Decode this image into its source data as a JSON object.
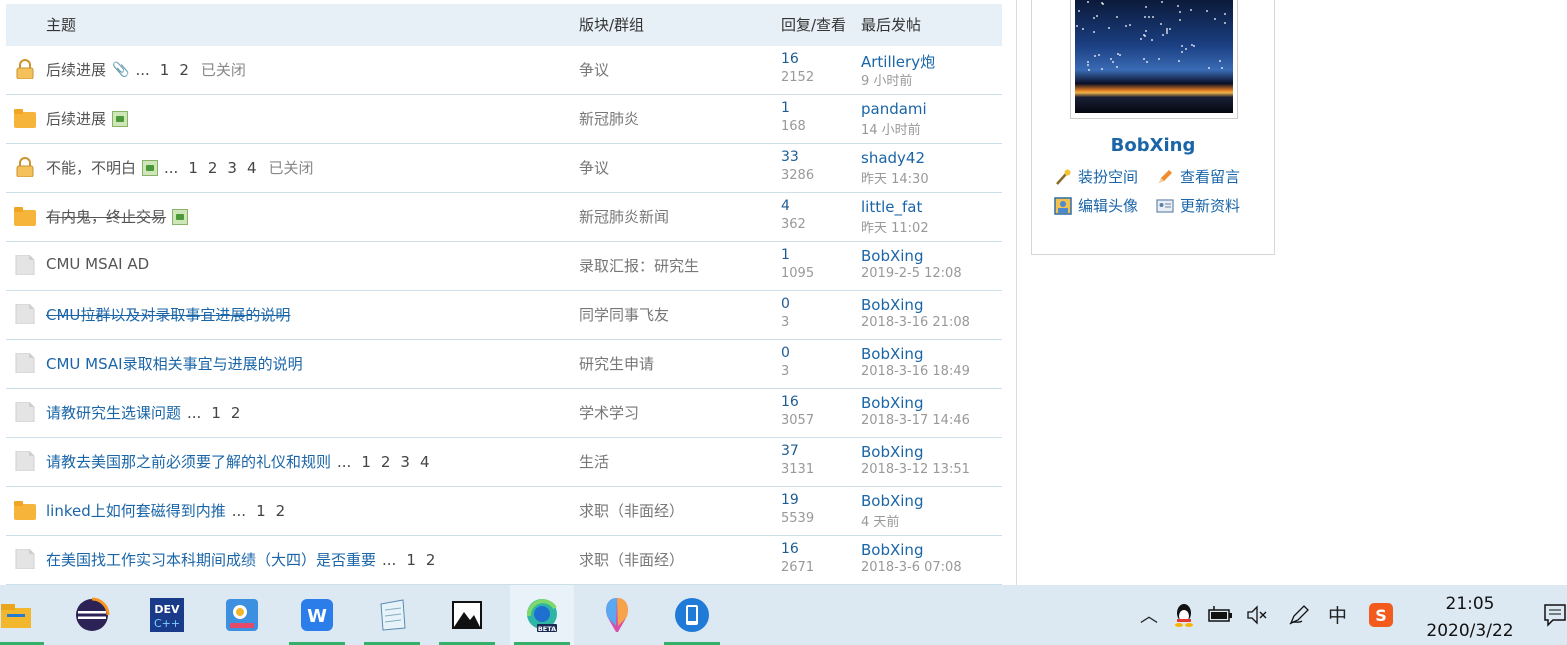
{
  "table": {
    "headers": {
      "topic": "主题",
      "forum": "版块/群组",
      "replies_views": "回复/查看",
      "last_post": "最后发帖"
    },
    "rows": [
      {
        "icon": "lock-icon",
        "title": "后续进展",
        "title_state": "read",
        "strike": false,
        "attachment": true,
        "image": false,
        "ellipsis": true,
        "pages": [
          "1",
          "2"
        ],
        "closed": "已关闭",
        "forum": "争议",
        "replies": "16",
        "views": "2152",
        "author": "Artillery炮",
        "time": "9 小时前"
      },
      {
        "icon": "folder-new-icon",
        "title": "后续进展",
        "title_state": "read",
        "strike": false,
        "attachment": false,
        "image": true,
        "ellipsis": false,
        "pages": [],
        "closed": "",
        "forum": "新冠肺炎",
        "replies": "1",
        "views": "168",
        "author": "pandami",
        "time": "14 小时前"
      },
      {
        "icon": "lock-icon",
        "title": "不能，不明白",
        "title_state": "read",
        "strike": false,
        "attachment": false,
        "image": true,
        "ellipsis": true,
        "pages": [
          "1",
          "2",
          "3",
          "4"
        ],
        "closed": "已关闭",
        "forum": "争议",
        "replies": "33",
        "views": "3286",
        "author": "shady42",
        "time": "昨天 14:30"
      },
      {
        "icon": "folder-new-icon",
        "title": "有内鬼，终止交易",
        "title_state": "read",
        "strike": true,
        "attachment": false,
        "image": true,
        "ellipsis": false,
        "pages": [],
        "closed": "",
        "forum": "新冠肺炎新闻",
        "replies": "4",
        "views": "362",
        "author": "little_fat",
        "time": "昨天 11:02"
      },
      {
        "icon": "document-icon",
        "title": "CMU MSAI AD",
        "title_state": "read",
        "strike": false,
        "attachment": false,
        "image": false,
        "ellipsis": false,
        "pages": [],
        "closed": "",
        "forum": "录取汇报：研究生",
        "replies": "1",
        "views": "1095",
        "author": "BobXing",
        "time": "2019-2-5 12:08"
      },
      {
        "icon": "document-icon",
        "title": "CMU拉群以及对录取事宜进展的说明",
        "title_state": "new",
        "strike": true,
        "attachment": false,
        "image": false,
        "ellipsis": false,
        "pages": [],
        "closed": "",
        "forum": "同学同事飞友",
        "replies": "0",
        "views": "3",
        "author": "BobXing",
        "time": "2018-3-16 21:08"
      },
      {
        "icon": "document-icon",
        "title": "CMU MSAI录取相关事宜与进展的说明",
        "title_state": "new",
        "strike": false,
        "attachment": false,
        "image": false,
        "ellipsis": false,
        "pages": [],
        "closed": "",
        "forum": "研究生申请",
        "replies": "0",
        "views": "3",
        "author": "BobXing",
        "time": "2018-3-16 18:49"
      },
      {
        "icon": "document-icon",
        "title": "请教研究生选课问题",
        "title_state": "new",
        "strike": false,
        "attachment": false,
        "image": false,
        "ellipsis": true,
        "pages": [
          "1",
          "2"
        ],
        "closed": "",
        "forum": "学术学习",
        "replies": "16",
        "views": "3057",
        "author": "BobXing",
        "time": "2018-3-17 14:46"
      },
      {
        "icon": "document-icon",
        "title": "请教去美国那之前必须要了解的礼仪和规则",
        "title_state": "new",
        "strike": false,
        "attachment": false,
        "image": false,
        "ellipsis": true,
        "pages": [
          "1",
          "2",
          "3",
          "4"
        ],
        "closed": "",
        "forum": "生活",
        "replies": "37",
        "views": "3131",
        "author": "BobXing",
        "time": "2018-3-12 13:51"
      },
      {
        "icon": "folder-new-icon",
        "title": "linked上如何套磁得到内推",
        "title_state": "new",
        "strike": false,
        "attachment": false,
        "image": false,
        "ellipsis": true,
        "pages": [
          "1",
          "2"
        ],
        "closed": "",
        "forum": "求职（非面经）",
        "replies": "19",
        "views": "5539",
        "author": "BobXing",
        "time": "4 天前"
      },
      {
        "icon": "document-icon",
        "title": "在美国找工作实习本科期间成绩（大四）是否重要",
        "title_state": "new",
        "strike": false,
        "attachment": false,
        "image": false,
        "ellipsis": true,
        "pages": [
          "1",
          "2"
        ],
        "closed": "",
        "forum": "求职（非面经）",
        "replies": "16",
        "views": "2671",
        "author": "BobXing",
        "time": "2018-3-6 07:08"
      }
    ]
  },
  "profile": {
    "name": "BobXing",
    "links": {
      "dress": "装扮空间",
      "messages": "查看留言",
      "edit_avatar": "编辑头像",
      "update_info": "更新资料"
    }
  },
  "taskbar": {
    "apps": [
      "file-explorer-icon",
      "eclipse-icon",
      "devcpp-icon",
      "photo-viewer-icon",
      "wps-icon",
      "notepad-icon",
      "photos-icon",
      "edge-beta-icon",
      "paint3d-icon",
      "phone-icon"
    ],
    "ime": "中",
    "clock_time": "21:05",
    "clock_date": "2020/3/22",
    "colors": {
      "bar": "#dce9f3",
      "running": "#35b06b"
    }
  }
}
